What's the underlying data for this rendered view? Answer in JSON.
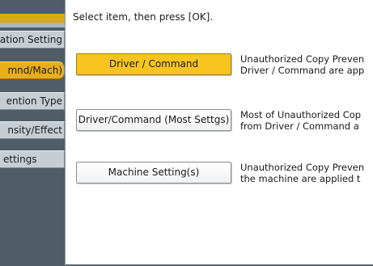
{
  "sidebar": {
    "items": [
      {
        "label": "ation Setting"
      },
      {
        "label": "mnd/Mach)"
      },
      {
        "label": "ention Type"
      },
      {
        "label": "nsity/Effect"
      },
      {
        "label": "ettings"
      }
    ],
    "selected_index": 1
  },
  "main": {
    "prompt": "Select item, then press [OK].",
    "options": [
      {
        "label": "Driver / Command",
        "desc_line1": "Unauthorized Copy Preven",
        "desc_line2": "Driver / Command are app"
      },
      {
        "label": "Driver/Command (Most Settgs)",
        "desc_line1": "Most of Unauthorized Cop",
        "desc_line2": "from Driver / Command a"
      },
      {
        "label": "Machine Setting(s)",
        "desc_line1": "Unauthorized Copy Preven",
        "desc_line2": "the machine are applied t"
      }
    ]
  },
  "colors": {
    "selected": "#f8c520",
    "sidebar_bg": "#4e5d68",
    "sidebar_item": "#c6ced4"
  }
}
